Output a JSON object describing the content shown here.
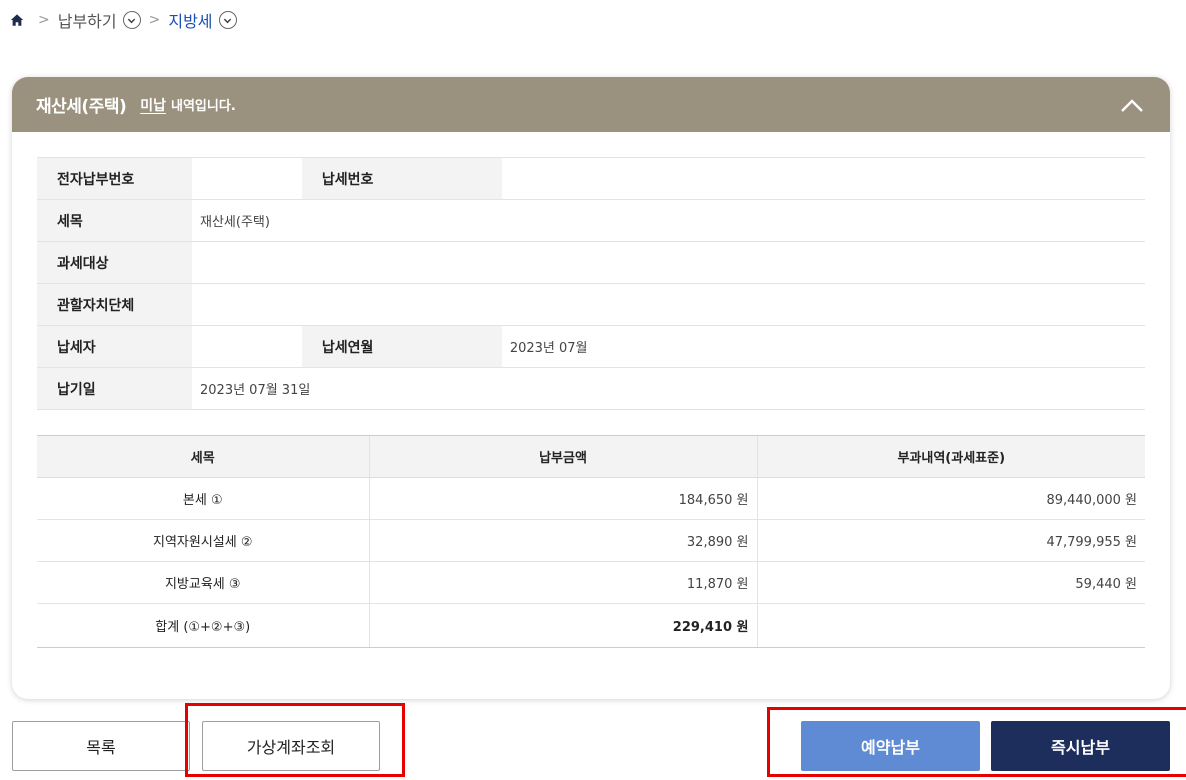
{
  "breadcrumb": {
    "home_icon": "home-icon",
    "separator": ">",
    "level1": "납부하기",
    "level2": "지방세"
  },
  "card": {
    "title": "재산세(주택)",
    "status": "미납",
    "message": "내역입니다.",
    "header_color": "#9b917f"
  },
  "info": {
    "electronic_payment_no_label": "전자납부번호",
    "electronic_payment_no_value": "",
    "tax_no_label": "납세번호",
    "tax_no_value": "",
    "tax_item_label": "세목",
    "tax_item_value": "재산세(주택)",
    "taxable_object_label": "과세대상",
    "taxable_object_value": "",
    "jurisdiction_label": "관할자치단체",
    "jurisdiction_value": "",
    "taxpayer_label": "납세자",
    "taxpayer_value": "",
    "tax_year_month_label": "납세연월",
    "tax_year_month_value": "2023년 07월",
    "due_date_label": "납기일",
    "due_date_value": "2023년 07월 31일"
  },
  "amounts": {
    "headers": [
      "세목",
      "납부금액",
      "부과내역(과세표준)"
    ],
    "rows": [
      {
        "item": "본세 ①",
        "amount": "184,650 원",
        "basis": "89,440,000 원"
      },
      {
        "item": "지역자원시설세 ②",
        "amount": "32,890 원",
        "basis": "47,799,955 원"
      },
      {
        "item": "지방교육세 ③",
        "amount": "11,870 원",
        "basis": "59,440 원"
      },
      {
        "item": "합계 (①+②+③)",
        "amount": "229,410 원",
        "basis": ""
      }
    ]
  },
  "buttons": {
    "list": "목록",
    "virtual_account": "가상계좌조회",
    "reserve_payment": "예약납부",
    "instant_payment": "즉시납부"
  },
  "colors": {
    "reserve_button": "#5f8bd4",
    "instant_button": "#1e2e5c",
    "highlight": "#e60000"
  }
}
